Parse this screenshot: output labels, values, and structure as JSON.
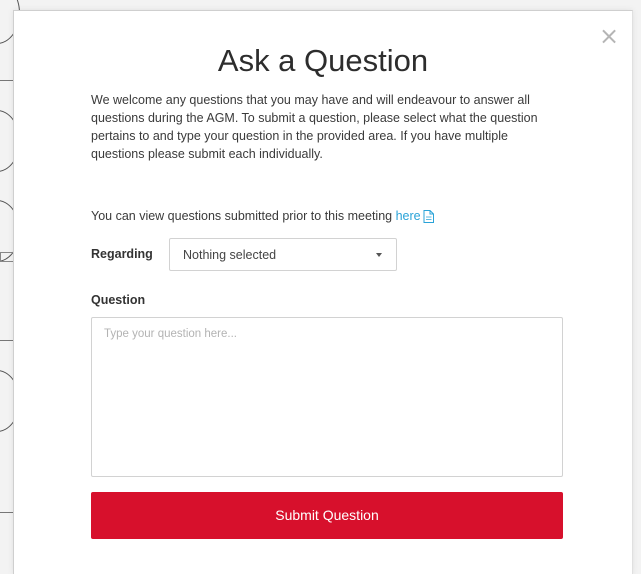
{
  "modal": {
    "title": "Ask a Question",
    "close_glyph": "×",
    "intro_text": "We welcome any questions that you may have and will endeavour to answer all questions during the AGM. To submit a question, please select what the question pertains to and type your question in the provided area. If you have multiple questions please submit each individually.",
    "prior_text": "You can view questions submitted prior to this meeting ",
    "prior_link_label": "here",
    "prior_link_icon": "document-icon"
  },
  "form": {
    "regarding_label": "Regarding",
    "regarding_value": "Nothing selected",
    "question_label": "Question",
    "question_placeholder": "Type your question here...",
    "question_value": "",
    "submit_label": "Submit Question"
  },
  "colors": {
    "accent": "#d7102c",
    "link": "#2aa3d8"
  }
}
